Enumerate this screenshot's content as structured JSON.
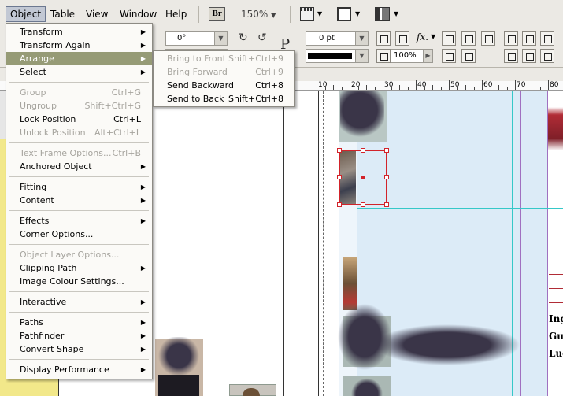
{
  "menubar": {
    "items": [
      "Object",
      "Table",
      "View",
      "Window",
      "Help"
    ],
    "badge": "Br",
    "zoom": "150%"
  },
  "control": {
    "angle": "0°",
    "stroke_weight": "0 pt",
    "percent": "100%",
    "p_glyph": "P"
  },
  "ruler": {
    "labels": [
      "10",
      "20",
      "30",
      "40",
      "50",
      "60",
      "70",
      "80"
    ]
  },
  "object_menu": {
    "groups": [
      [
        {
          "label": "Transform",
          "submenu": true
        },
        {
          "label": "Transform Again",
          "submenu": true
        },
        {
          "label": "Arrange",
          "submenu": true,
          "selected": true
        },
        {
          "label": "Select",
          "submenu": true
        }
      ],
      [
        {
          "label": "Group",
          "shortcut": "Ctrl+G",
          "disabled": true
        },
        {
          "label": "Ungroup",
          "shortcut": "Shift+Ctrl+G",
          "disabled": true
        },
        {
          "label": "Lock Position",
          "shortcut": "Ctrl+L"
        },
        {
          "label": "Unlock Position",
          "shortcut": "Alt+Ctrl+L",
          "disabled": true
        }
      ],
      [
        {
          "label": "Text Frame Options...",
          "shortcut": "Ctrl+B",
          "disabled": true
        },
        {
          "label": "Anchored Object",
          "submenu": true
        }
      ],
      [
        {
          "label": "Fitting",
          "submenu": true
        },
        {
          "label": "Content",
          "submenu": true
        }
      ],
      [
        {
          "label": "Effects",
          "submenu": true
        },
        {
          "label": "Corner Options..."
        }
      ],
      [
        {
          "label": "Object Layer Options...",
          "disabled": true
        },
        {
          "label": "Clipping Path",
          "submenu": true
        },
        {
          "label": "Image Colour Settings..."
        }
      ],
      [
        {
          "label": "Interactive",
          "submenu": true
        }
      ],
      [
        {
          "label": "Paths",
          "submenu": true
        },
        {
          "label": "Pathfinder",
          "submenu": true
        },
        {
          "label": "Convert Shape",
          "submenu": true
        }
      ],
      [
        {
          "label": "Display Performance",
          "submenu": true
        }
      ]
    ]
  },
  "arrange_menu": {
    "items": [
      {
        "label": "Bring to Front",
        "shortcut": "Shift+Ctrl+9",
        "disabled": true
      },
      {
        "label": "Bring Forward",
        "shortcut": "Ctrl+9",
        "disabled": true
      },
      {
        "label": "Send Backward",
        "shortcut": "Ctrl+8"
      },
      {
        "label": "Send to Back",
        "shortcut": "Shift+Ctrl+8"
      }
    ]
  },
  "page_text": {
    "lines": [
      "Ing",
      "Gu",
      "Luc"
    ]
  },
  "colors": {
    "menu_highlight": "#969b76",
    "guide": "#36c8c8",
    "selection": "#d2232a",
    "frame_fill": "#dcebf7",
    "redacted": "#3a3548"
  }
}
